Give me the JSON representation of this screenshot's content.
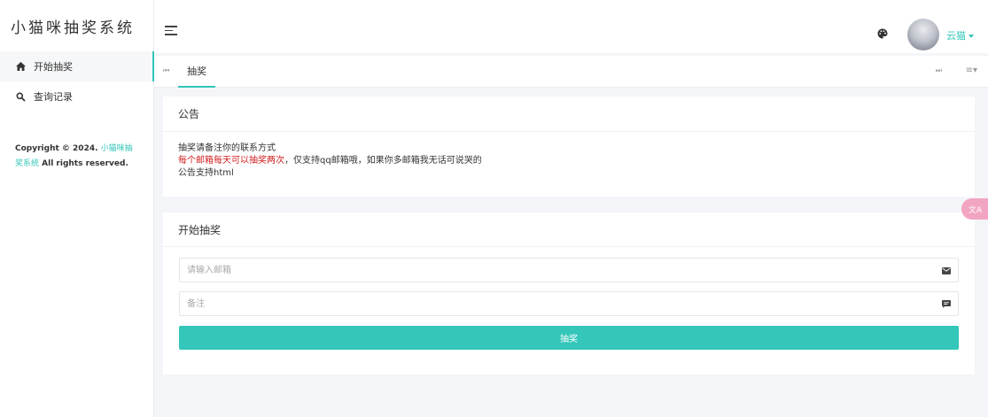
{
  "app": {
    "brand": "小猫咪抽奖系统"
  },
  "sidebar": {
    "items": [
      {
        "label": "开始抽奖",
        "icon": "home-icon",
        "active": true
      },
      {
        "label": "查询记录",
        "icon": "search-icon",
        "active": false
      }
    ],
    "copyright": {
      "prefix": "Copyright © 2024. ",
      "link": "小猫咪抽奖系统",
      "suffix": " All rights reserved."
    }
  },
  "header": {
    "theme_icon": "palette-icon",
    "user_name": "云猫"
  },
  "tabs": [
    {
      "label": "抽奖",
      "active": true
    }
  ],
  "notice": {
    "title": "公告",
    "line1": "抽奖请备注你的联系方式",
    "line2_red": "每个邮箱每天可以抽奖两次",
    "line2_rest": "，仅支持qq邮箱哦，如果你多邮箱我无话可说哭的",
    "line3": "公告支持html"
  },
  "form": {
    "title": "开始抽奖",
    "email_placeholder": "请输入邮箱",
    "note_placeholder": "备注",
    "submit_label": "抽奖"
  },
  "translate_badge": "文A",
  "colors": {
    "accent": "#33c6b9",
    "notice_red": "#d11f1f"
  }
}
